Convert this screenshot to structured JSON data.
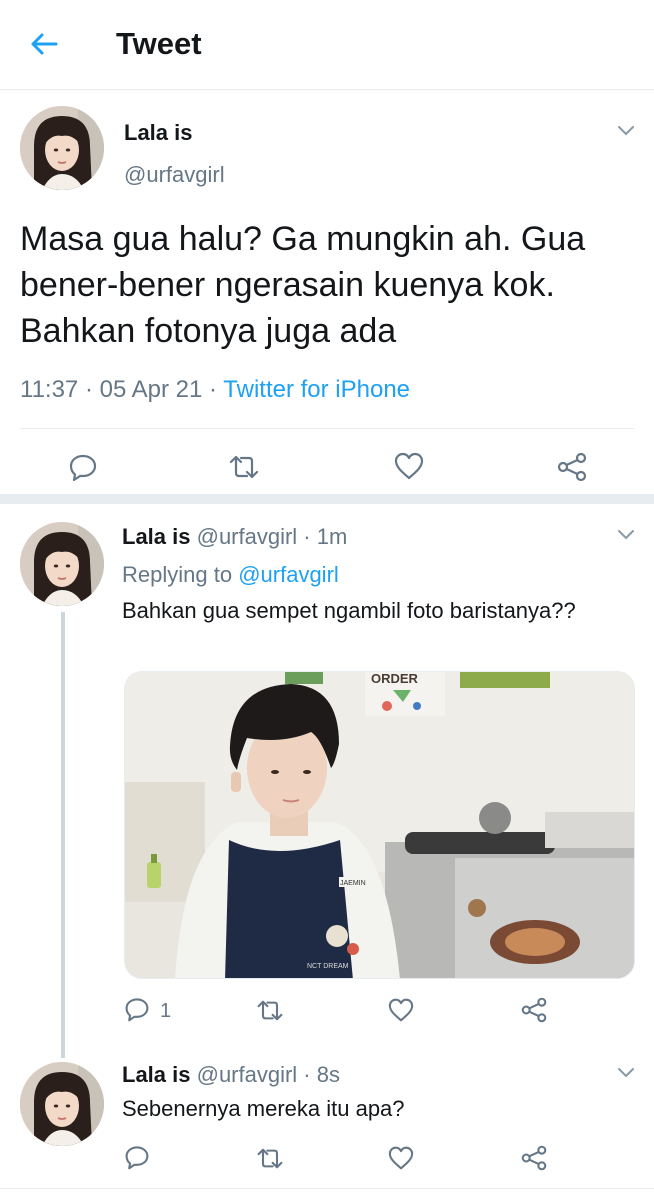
{
  "header": {
    "title": "Tweet",
    "back_icon": "arrow-left-icon",
    "accent": "#1da1f2"
  },
  "main_tweet": {
    "name": "Lala is",
    "handle": "@urfavgirl",
    "text": "Masa gua halu? Ga mungkin ah. Gua bener-bener ngerasain kuenya kok. Bahkan fotonya juga ada",
    "time": "11:37",
    "date": "05 Apr 21",
    "source": "Twitter for iPhone",
    "sep": "·",
    "actions": [
      "reply-icon",
      "retweet-icon",
      "like-icon",
      "share-icon"
    ]
  },
  "replies": [
    {
      "name": "Lala is",
      "meta": "@urfavgirl · 1m",
      "replying_label": "Replying to",
      "replying_handle": "@urfavgirl",
      "text": "Bahkan gua sempet ngambil foto baristanya??",
      "has_media": true,
      "reply_count": "1"
    },
    {
      "name": "Lala is",
      "meta": "@urfavgirl · 8s",
      "text": "Sebenernya mereka itu apa?",
      "has_media": false,
      "reply_count": ""
    }
  ],
  "photo": {
    "sign_text": "ORDER",
    "apron_badge": "JAEMIN",
    "apron_text": "NCT DREAM"
  },
  "colors": {
    "text": "#14171a",
    "secondary": "#657786",
    "divider": "#e6ecf0",
    "link": "#1da1f2"
  }
}
